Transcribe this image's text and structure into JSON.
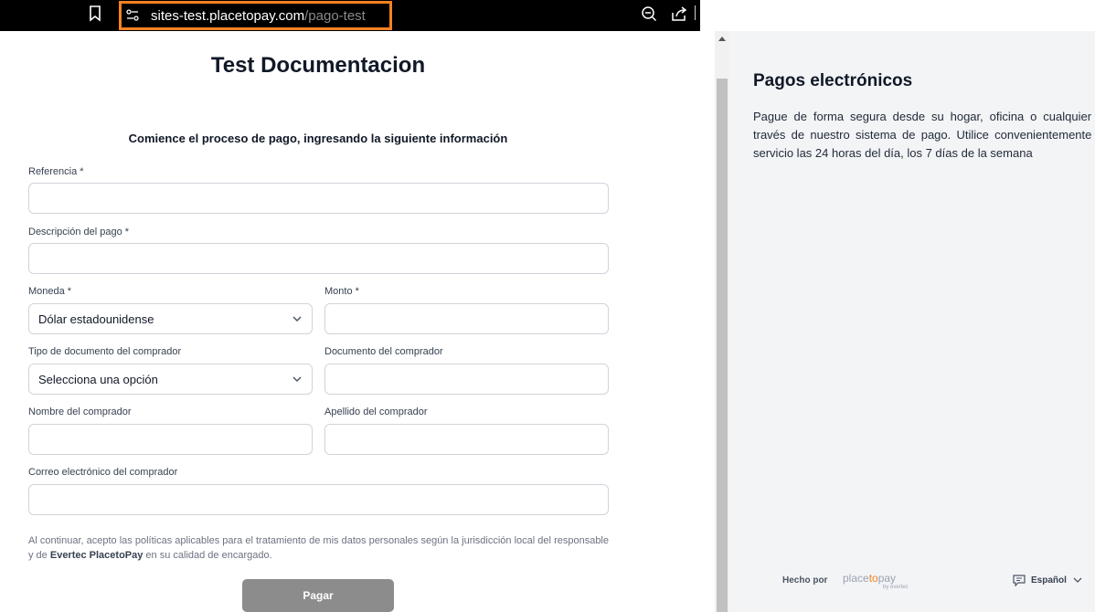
{
  "browser": {
    "url_host": "sites-test.placetopay.com",
    "url_path": "/pago-test"
  },
  "form": {
    "title": "Test Documentacion",
    "subtitle": "Comience el proceso de pago, ingresando la siguiente información",
    "reference_label": "Referencia *",
    "reference_value": "",
    "description_label": "Descripción del pago *",
    "description_value": "",
    "currency_label": "Moneda *",
    "currency_value": "Dólar estadounidense",
    "amount_label": "Monto *",
    "amount_value": "",
    "doc_type_label": "Tipo de documento del comprador",
    "doc_type_value": "Selecciona una opción",
    "doc_label": "Documento del comprador",
    "doc_value": "",
    "first_name_label": "Nombre del comprador",
    "first_name_value": "",
    "last_name_label": "Apellido del comprador",
    "last_name_value": "",
    "email_label": "Correo electrónico del comprador",
    "email_value": "",
    "disclaimer_pre": "Al continuar, acepto las políticas aplicables para el tratamiento de mis datos personales según la jurisdicción local del responsable y de ",
    "disclaimer_bold": "Evertec PlacetoPay",
    "disclaimer_post": " en su calidad de encargado.",
    "pay_label": "Pagar"
  },
  "info": {
    "title": "Pagos electrónicos",
    "text": "Pague de forma segura desde su hogar, oficina o cualquier lugar a través de nuestro sistema de pago. Utilice convenientemente nuestro servicio las 24 horas del día, los 7 días de la semana"
  },
  "footer": {
    "made_by": "Hecho por",
    "brand_prefix": "place",
    "brand_accent": "to",
    "brand_suffix": "pay",
    "brand_sub": "by evertec",
    "language": "Español"
  },
  "colors": {
    "url_highlight": "#f58220",
    "pay_button": "#8c8c8c",
    "panel_bg": "#f3f4f6"
  }
}
